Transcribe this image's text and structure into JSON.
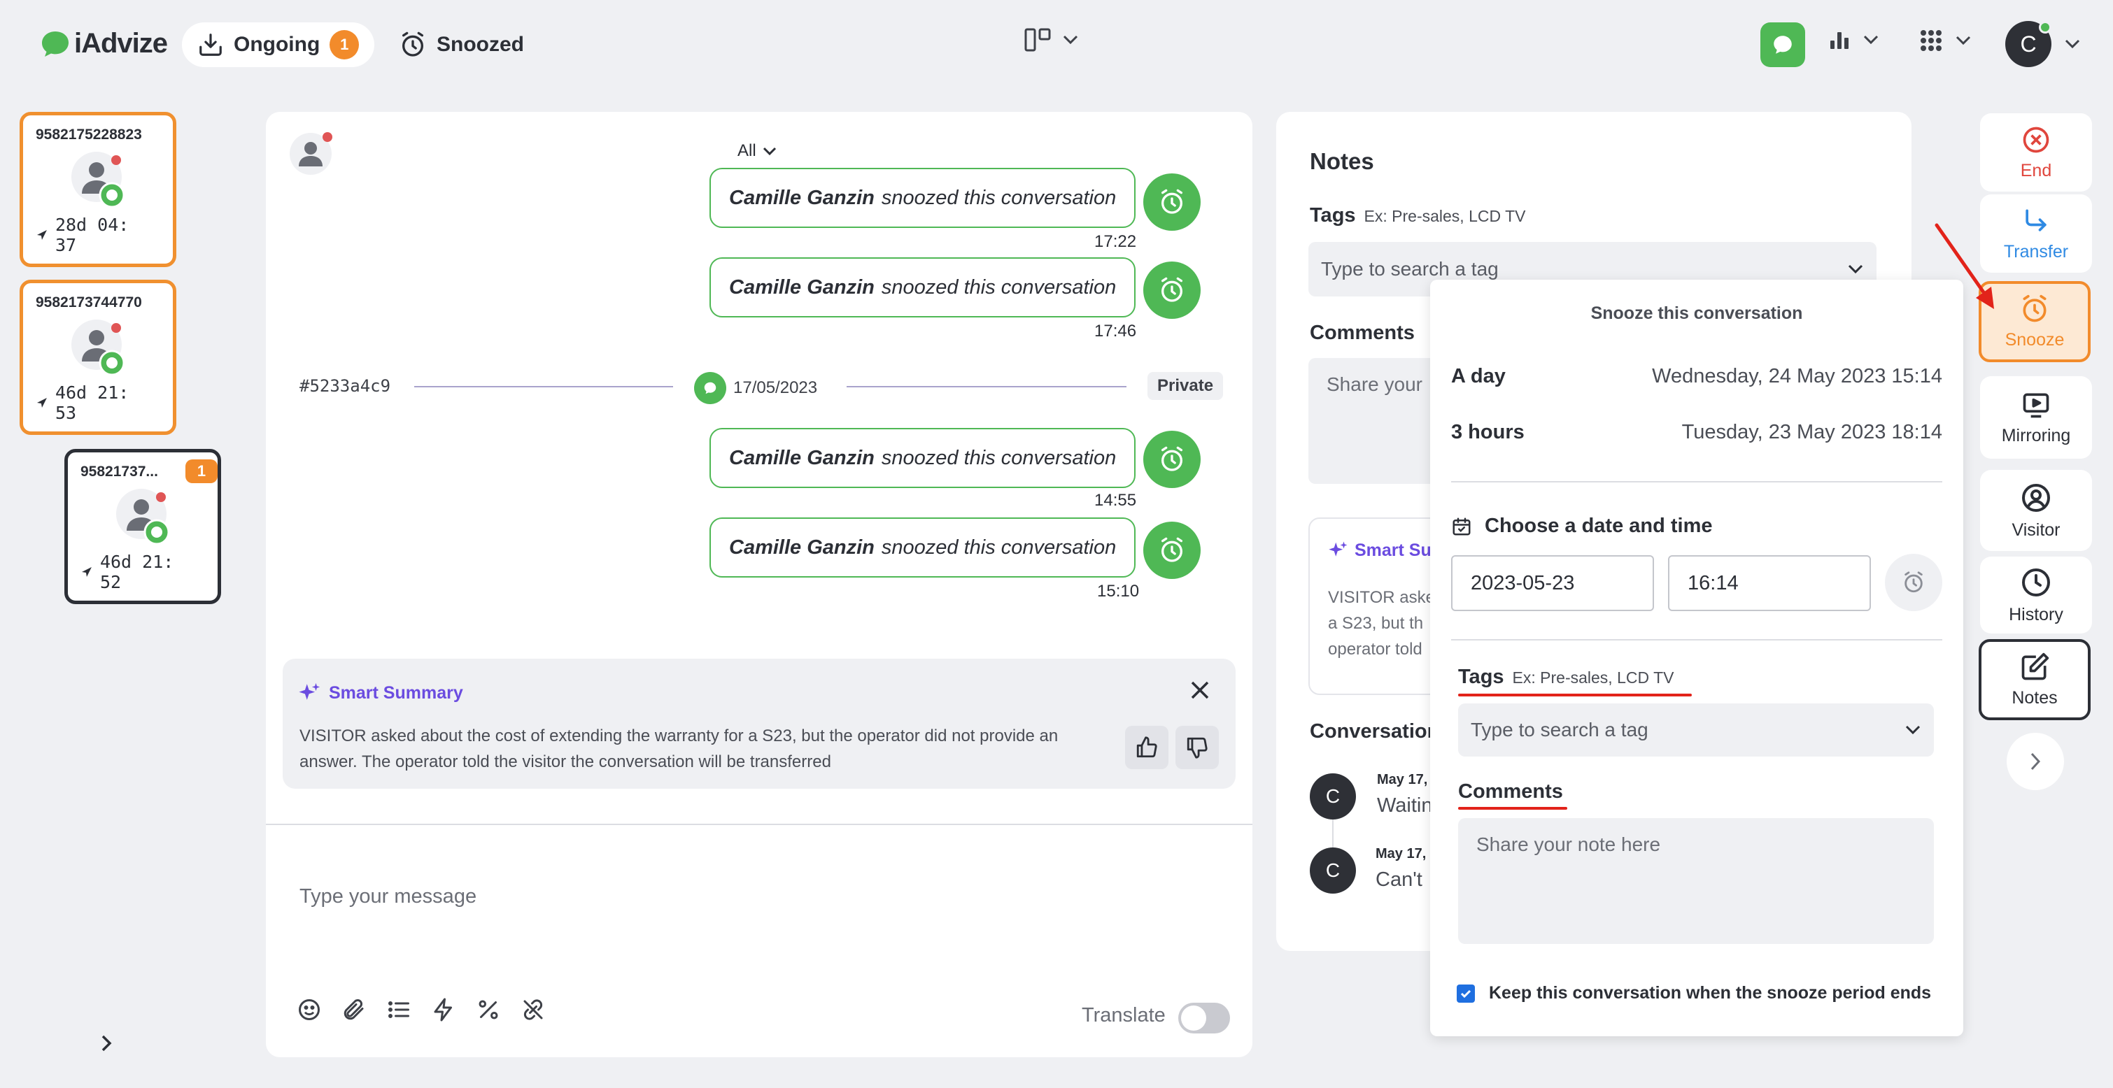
{
  "app": {
    "brand": "iAdvize"
  },
  "topbar": {
    "tabs": [
      {
        "label": "Ongoing",
        "count": "1"
      },
      {
        "label": "Snoozed"
      }
    ]
  },
  "conversations": [
    {
      "id": "9582175228823",
      "time": "28d 04: 37"
    },
    {
      "id": "9582173744770",
      "time": "46d 21: 53"
    },
    {
      "id": "95821737...",
      "time": "46d 21: 52",
      "badge": "1"
    }
  ],
  "chat": {
    "filter": "All",
    "messages": [
      {
        "author": "Camille Ganzin",
        "text": "snoozed this conversation",
        "time": "17:22"
      },
      {
        "author": "Camille Ganzin",
        "text": "snoozed this conversation",
        "time": "17:46"
      },
      {
        "author": "Camille Ganzin",
        "text": "snoozed this conversation",
        "time": "14:55"
      },
      {
        "author": "Camille Ganzin",
        "text": "snoozed this conversation",
        "time": "15:10"
      }
    ],
    "separator": {
      "id": "#5233a4c9",
      "date": "17/05/2023",
      "tag": "Private"
    },
    "smart_summary": {
      "title": "Smart Summary",
      "text": "VISITOR asked about the cost of extending the warranty for a S23, but the operator did not provide an answer. The operator told the visitor the conversation will be transferred"
    },
    "composer_placeholder": "Type your message",
    "translate_label": "Translate"
  },
  "notes": {
    "title": "Notes",
    "tags_label": "Tags",
    "tags_hint": "Ex: Pre-sales, LCD TV",
    "tags_placeholder": "Type to search a tag",
    "comments_label": "Comments",
    "comments_placeholder_partial": "Share your",
    "smart_card": {
      "title": "Smart Su",
      "lines": [
        "VISITOR aske",
        "a S23, but th",
        "operator told"
      ]
    },
    "conversation_title": "Conversation",
    "history": [
      {
        "initial": "C",
        "date": "May 17,",
        "text": "Waitin"
      },
      {
        "initial": "C",
        "date": "May 17,",
        "text": "Can't"
      }
    ]
  },
  "snooze": {
    "title": "Snooze this conversation",
    "options": [
      {
        "label": "A day",
        "value": "Wednesday, 24 May 2023 15:14"
      },
      {
        "label": "3 hours",
        "value": "Tuesday, 23 May 2023 18:14"
      }
    ],
    "choose_label": "Choose a date and time",
    "date_value": "2023-05-23",
    "time_value": "16:14",
    "tags_label": "Tags",
    "tags_hint": "Ex: Pre-sales, LCD TV",
    "tags_placeholder": "Type to search a tag",
    "comments_label": "Comments",
    "comments_placeholder": "Share your note here",
    "keep_label": "Keep this conversation when the snooze period ends",
    "keep_checked": true
  },
  "rail": {
    "end": "End",
    "transfer": "Transfer",
    "snooze": "Snooze",
    "mirroring": "Mirroring",
    "visitor": "Visitor",
    "history": "History",
    "notes": "Notes"
  },
  "colors": {
    "accent_green": "#4fb855",
    "accent_orange": "#f28b2b",
    "purple": "#6b4ce0",
    "red": "#e2231a"
  }
}
